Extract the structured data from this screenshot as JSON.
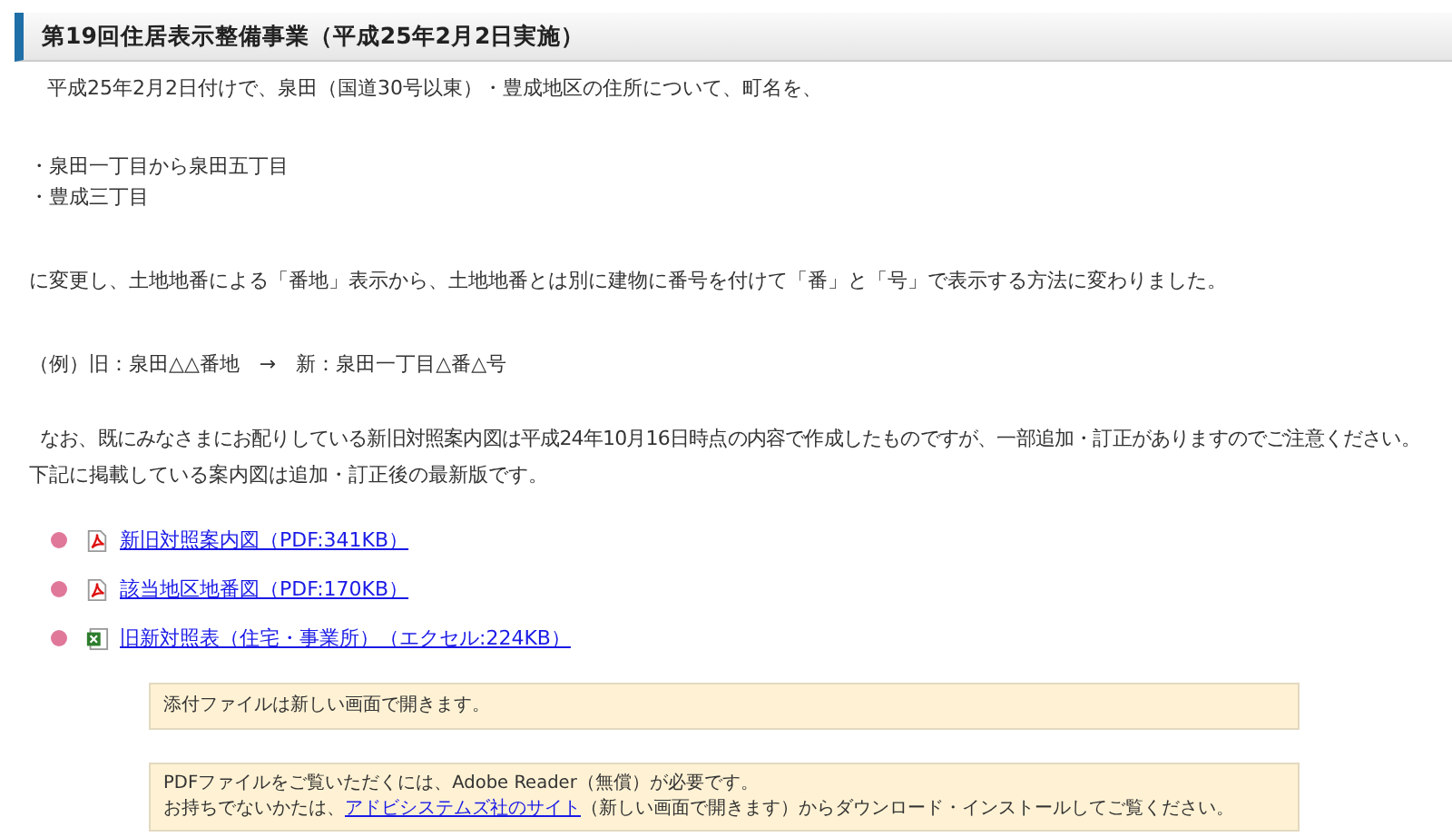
{
  "heading": "第19回住居表示整備事業（平成25年2月2日実施）",
  "intro": "平成25年2月2日付けで、泉田（国道30号以東）・豊成地区の住所について、町名を、",
  "bullets": [
    "・泉田一丁目から泉田五丁目",
    "・豊成三丁目"
  ],
  "change": "に変更し、土地地番による「番地」表示から、土地地番とは別に建物に番号を付けて「番」と「号」で表示する方法に変わりました。",
  "example": "（例）旧：泉田△△番地　→　新：泉田一丁目△番△号",
  "note_lines": [
    "なお、既にみなさまにお配りしている新旧対照案内図は平成24年10月16日時点の内容で作成したものですが、一部追加・訂正がありますのでご注意ください。",
    "下記に掲載している案内図は追加・訂正後の最新版です。"
  ],
  "files": [
    {
      "kind": "pdf",
      "label": "新旧対照案内図（PDF:341KB）"
    },
    {
      "kind": "pdf",
      "label": "該当地区地番図（PDF:170KB）"
    },
    {
      "kind": "excel",
      "label": "旧新対照表（住宅・事業所）（エクセル:224KB）"
    }
  ],
  "notice": "添付ファイルは新しい画面で開きます。",
  "reader_notice": {
    "line_1": "PDFファイルをご覧いただくには、Adobe Reader（無償）が必要です。",
    "before_link": "お持ちでないかたは、",
    "link": "アドビシステムズ社のサイト",
    "after_link": "（新しい画面で開きます）からダウンロード・インストールしてご覧ください。"
  }
}
